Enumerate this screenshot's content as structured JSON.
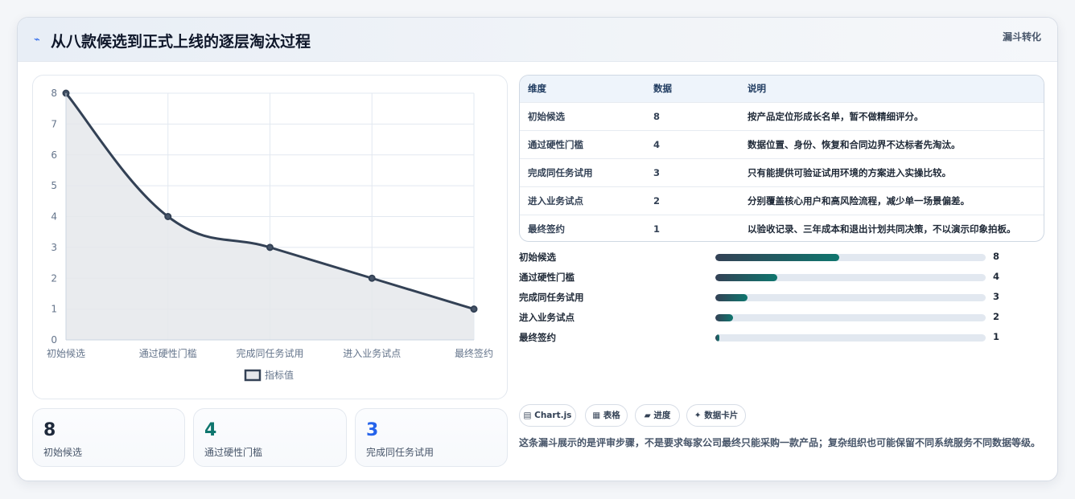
{
  "header": {
    "title": "从八款候选到正式上线的逐层淘汰过程",
    "tag": "漏斗转化",
    "icon": "lightning-icon"
  },
  "chart_data": {
    "type": "area",
    "categories": [
      "初始候选",
      "通过硬性门槛",
      "完成同任务试用",
      "进入业务试点",
      "最终签约"
    ],
    "series": [
      {
        "name": "指标值",
        "values": [
          8,
          4,
          3,
          2,
          1
        ]
      }
    ],
    "ylim": [
      0,
      8
    ],
    "yticks": [
      0,
      1,
      2,
      3,
      4,
      5,
      6,
      7,
      8
    ],
    "grid": true,
    "legend": "bottom",
    "colors": {
      "line": "#334155",
      "fill": "#e5e7eb"
    }
  },
  "stats": [
    {
      "value": "8",
      "label": "初始候选",
      "color": "#1e293b"
    },
    {
      "value": "4",
      "label": "通过硬性门槛",
      "color": "#0f766e"
    },
    {
      "value": "3",
      "label": "完成同任务试用",
      "color": "#2563eb"
    }
  ],
  "table": {
    "headers": [
      "维度",
      "数据",
      "说明"
    ],
    "rows": [
      [
        "初始候选",
        "8",
        "按产品定位形成长名单，暂不做精细评分。"
      ],
      [
        "通过硬性门槛",
        "4",
        "数据位置、身份、恢复和合同边界不达标者先淘汰。"
      ],
      [
        "完成同任务试用",
        "3",
        "只有能提供可验证试用环境的方案进入实操比较。"
      ],
      [
        "进入业务试点",
        "2",
        "分别覆盖核心用户和高风险流程，减少单一场景偏差。"
      ],
      [
        "最终签约",
        "1",
        "以验收记录、三年成本和退出计划共同决策，不以演示印象拍板。"
      ]
    ]
  },
  "progress": [
    {
      "label": "初始候选",
      "value": 8,
      "max": 17.5
    },
    {
      "label": "通过硬性门槛",
      "value": 4,
      "max": 17.5
    },
    {
      "label": "完成同任务试用",
      "value": 3,
      "max": 25
    },
    {
      "label": "进入业务试点",
      "value": 2,
      "max": 30
    },
    {
      "label": "最终签约",
      "value": 1,
      "max": 63
    }
  ],
  "pills": [
    "▤ Chart.js",
    "▦ 表格",
    "▰ 进度",
    "✦ 数据卡片"
  ],
  "note": "这条漏斗展示的是评审步骤，不是要求每家公司最终只能采购一款产品；复杂组织也可能保留不同系统服务不同数据等级。"
}
